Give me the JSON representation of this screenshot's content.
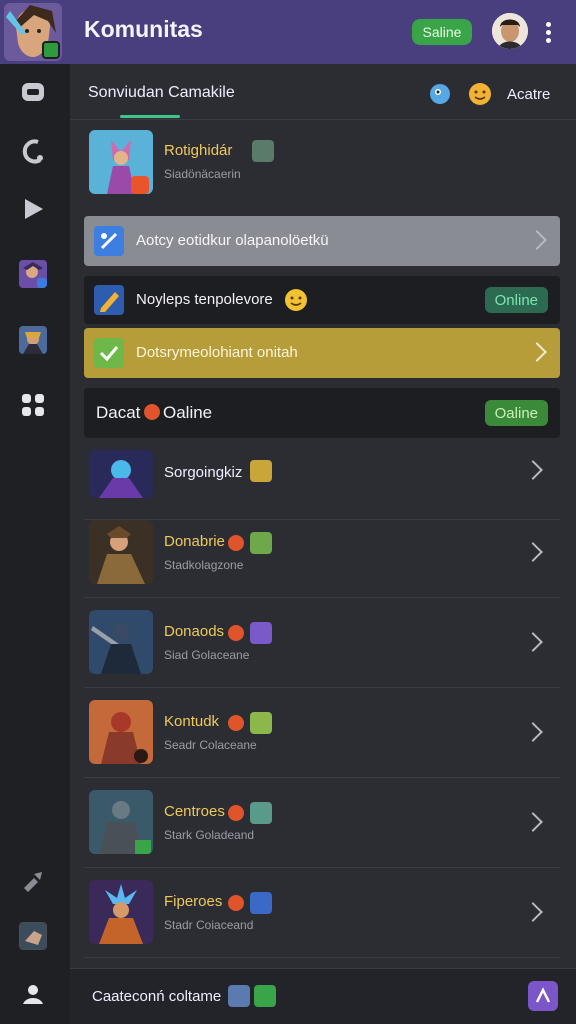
{
  "app": {
    "title": "Komunitas",
    "status": "Saline",
    "menu_icon": "kebab-icon"
  },
  "header": {
    "title": "Sonviudan Camakile",
    "action": "Acatre"
  },
  "featured": {
    "name": "Rotighidár",
    "sub": "Siadönäcaerin"
  },
  "bands": [
    {
      "label": "Aotcy eotidkur olapanolöetkü"
    },
    {
      "label": "Noyleps tenpolevore",
      "pill": "Online"
    },
    {
      "label": "Dotsrymeolohiant onitah"
    }
  ],
  "section": {
    "title": "Dacat",
    "pill": "Oaline"
  },
  "list": [
    {
      "name": "Sorgoingkiz",
      "sub": ""
    },
    {
      "name": "Donabrie",
      "sub": "Stadkolagzone"
    },
    {
      "name": "Donaods",
      "sub": "Siad Golaceane"
    },
    {
      "name": "Kontudk",
      "sub": "Seadr Colaceane"
    },
    {
      "name": "Centroes",
      "sub": "Stark Goladeand"
    },
    {
      "name": "Fiperoes",
      "sub": "Stadr Coiaceand"
    }
  ],
  "footer": {
    "label": "Caateconń coltame"
  },
  "colors": {
    "topbar": "#4a3f7e",
    "accent_green": "#3aa548",
    "gold": "#f0c95a",
    "band_gold": "#b79d3a"
  }
}
